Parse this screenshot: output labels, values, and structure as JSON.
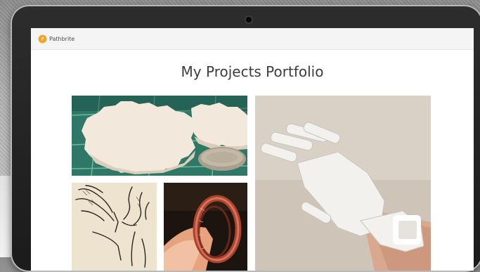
{
  "app": {
    "brand": "Pathbrite",
    "logo_icon": "pathbrite-logo-icon",
    "accent_color": "#f5a21b"
  },
  "page": {
    "title": "My Projects Portfolio"
  },
  "portfolio": {
    "items": [
      {
        "icon": "3d-printed-gears-photo"
      },
      {
        "icon": "3d-printed-prosthetic-hand-photo"
      },
      {
        "icon": "hand-sketch-drawing"
      },
      {
        "icon": "printed-wrist-brace-photo"
      }
    ]
  }
}
